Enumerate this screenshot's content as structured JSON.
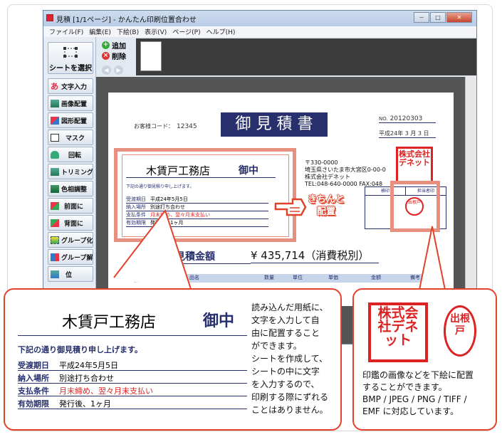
{
  "window": {
    "title": "見積 [1/1ページ] - かんたん印刷位置合わせ",
    "menu": [
      "ファイル(F)",
      "編集(E)",
      "下絵(B)",
      "表示(V)",
      "ページ(P)",
      "ヘルプ(H)"
    ],
    "controls": {
      "minimize": "－",
      "maximize": "□",
      "close": "✕"
    }
  },
  "sidebar": {
    "select_label": "シートを選択",
    "items": [
      "文字入力",
      "画像配置",
      "図形配置",
      "マスク",
      "回転",
      "トリミング",
      "色相調整",
      "前面に",
      "背面に",
      "グループ化",
      "グループ解除",
      "位"
    ]
  },
  "toolbar": {
    "add_label": "追加",
    "delete_label": "削除",
    "add_icon": "+",
    "delete_icon": "×"
  },
  "doc": {
    "customer_code_label": "お客様コード：",
    "customer_code": "12345",
    "title": "御 見 積 書",
    "no_label": "NO.",
    "no_value": "20120303",
    "date": "平成24年 3 月 3 日",
    "company_name": "木賃戸工務店",
    "honorific": "御中",
    "intro": "下記の通り御見積り申し上げます。",
    "rows": [
      {
        "label": "受渡期日",
        "value": "平成24年5月5日",
        "red": false
      },
      {
        "label": "納入場所",
        "value": "別途打ち合わせ",
        "red": false
      },
      {
        "label": "支払条件",
        "value": "月末締め、翌々月末支払い",
        "red": true
      },
      {
        "label": "有効期限",
        "value": "発行後、1ヶ月",
        "red": false
      }
    ],
    "address": [
      "〒330-0000",
      "埼玉県さいたま市大宮区0-00-0",
      "株式会社デネット",
      "TEL:048-640-0000 FAX:048"
    ],
    "stamp_text": "株式会社デネット",
    "seal_text": "出根戸",
    "inspection_headers": [
      "検印",
      "担当者印"
    ],
    "total_label": "御見積金額",
    "total_value": "¥ 435,714（消費税別）",
    "table_headers": [
      "品名",
      "数量",
      "単位",
      "単価",
      "金額",
      "備考"
    ]
  },
  "pointer_label": [
    "きちんと",
    "配置"
  ],
  "callout_left": {
    "company_name": "木賃戸工務店",
    "honorific": "御中",
    "intro": "下記の通り御見積り申し上げます。",
    "rows": [
      {
        "label": "受渡期日",
        "value": "平成24年5月5日",
        "red": false
      },
      {
        "label": "納入場所",
        "value": "別途打ち合わせ",
        "red": false
      },
      {
        "label": "支払条件",
        "value": "月末締め、翌々月末支払い",
        "red": true
      },
      {
        "label": "有効期限",
        "value": "発行後、1ヶ月",
        "red": false
      }
    ],
    "description": [
      "読み込んだ用紙に、",
      "文字を入力して自",
      "由に配置すること",
      "ができます。",
      "シートを作成して、",
      "シートの中に文字",
      "を入力するので、",
      "印刷する際にずれる",
      "ことはありません。"
    ]
  },
  "callout_right": {
    "stamp_text": "株式会社デネット",
    "seal_text": "出根戸",
    "description": [
      "印鑑の画像などを下絵に配置",
      "することができます。",
      "BMP / JPEG / PNG / TIFF /",
      "EMF に対応しています。"
    ]
  },
  "colors": {
    "accent_red": "#e0432a",
    "frame_pink": "#e8907f",
    "navy": "#27306d"
  }
}
